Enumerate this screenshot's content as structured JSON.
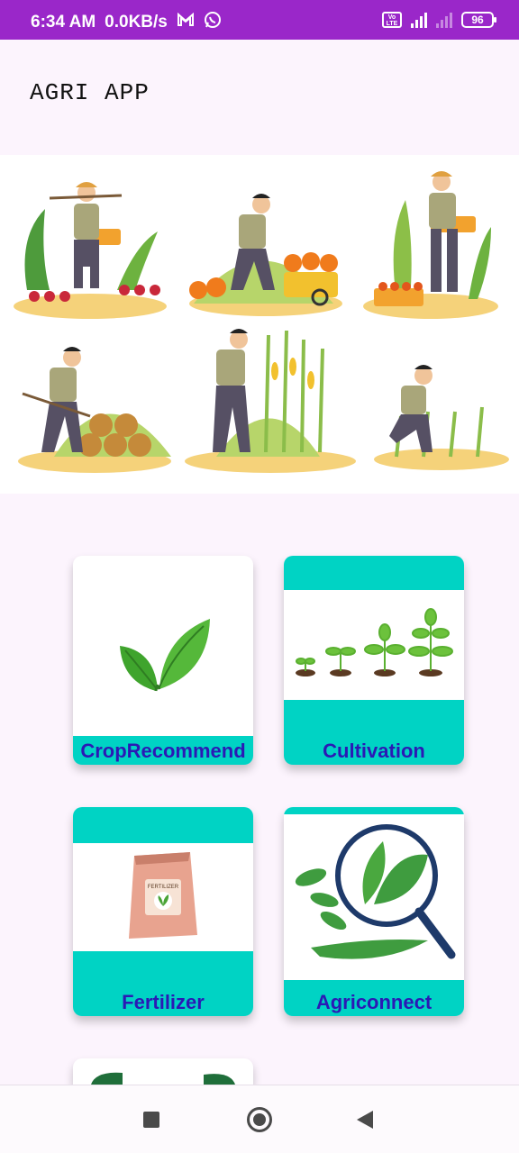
{
  "status_bar": {
    "time": "6:34 AM",
    "speed": "0.0KB/s",
    "icons": [
      "gmail-icon",
      "whatsapp-icon",
      "volte-icon",
      "signal-4g-icon",
      "signal-icon",
      "battery-icon"
    ],
    "network": "4G",
    "volte": "Vo LTE",
    "battery": "96"
  },
  "header": {
    "title": "AGRI APP"
  },
  "banner": {
    "description_icon": "farmers-illustration"
  },
  "cards": [
    {
      "label": "CropRecommend",
      "icon": "leaf-icon"
    },
    {
      "label": "Cultivation",
      "icon": "seedling-growth-icon"
    },
    {
      "label": "Fertilizer",
      "icon": "fertilizer-bag-icon"
    },
    {
      "label": "Agriconnect",
      "icon": "magnifier-leaf-icon"
    }
  ],
  "colors": {
    "status_bar": "#9a27c9",
    "accent": "#00d3c4",
    "label_text": "#2b19b5",
    "background": "#fcf4fd"
  },
  "nav": {
    "recent": "recent-apps-icon",
    "home": "home-icon",
    "back": "back-icon"
  }
}
